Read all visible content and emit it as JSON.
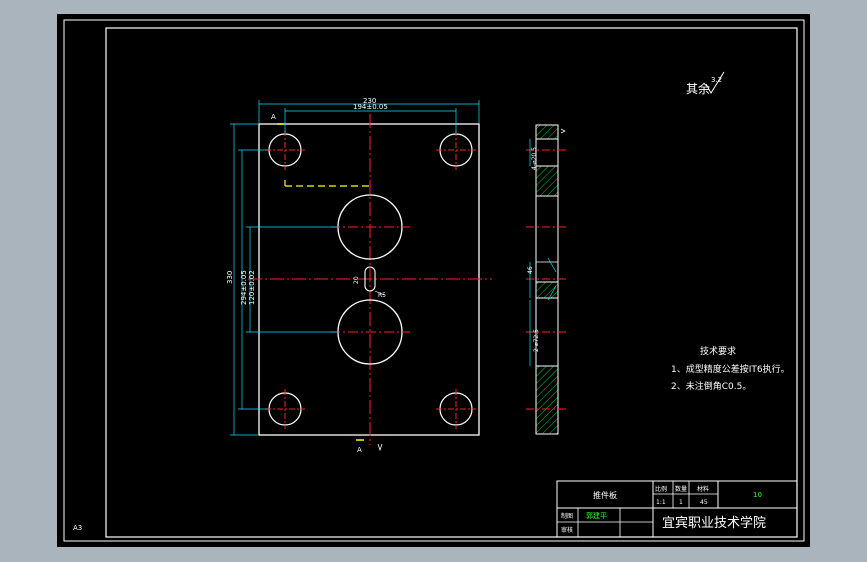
{
  "drawing": {
    "roughness_note": "其余",
    "roughness_value": "3.2",
    "sheet_size": "A3",
    "front_view": {
      "dim_overall_width": "230",
      "dim_hole_pitch_x": "194±0.05",
      "dim_overall_height": "330",
      "dim_hole_pitch_y": "294±0.05",
      "dim_center_pitch": "120±0.02",
      "section_mark_top": "A",
      "section_mark_bottom": "A",
      "slot_label_1": "20",
      "slot_label_2": "R5"
    },
    "section_view": {
      "dim_top": "4-⌀20.5",
      "dim_mid": "46",
      "dim_bottom": "2-⌀72.5"
    },
    "tech_requirements": {
      "title": "技术要求",
      "item1": "1、成型精度公差按IT6执行。",
      "item2": "2、未注倒角C0.5。"
    },
    "title_block": {
      "part_name": "推件板",
      "scale_label": "比例",
      "qty_label": "数量",
      "material_label": "材料",
      "scale_value": "1:1",
      "qty_value": "1",
      "material_value": "45",
      "drawing_no": "10",
      "designer_label": "制图",
      "designer_name": "郭建平",
      "reviewer_label": "审核",
      "school": "宜宾职业技术学院"
    }
  }
}
